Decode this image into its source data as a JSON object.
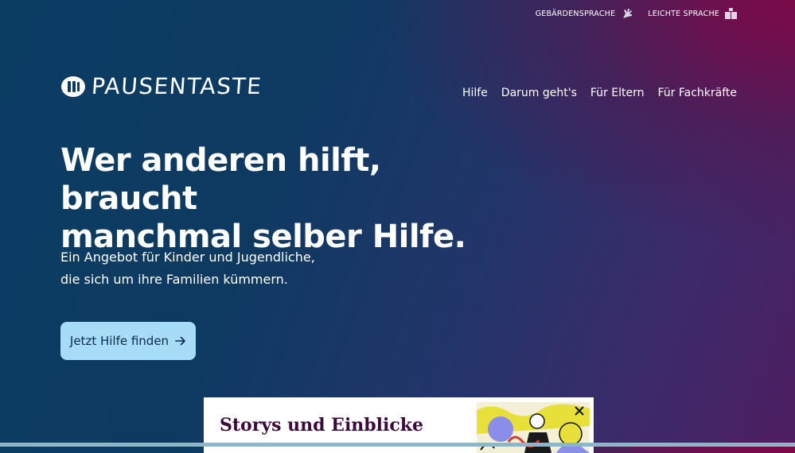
{
  "topbar": {
    "sign_language_label": "GEBÄRDENSPRACHE",
    "easy_language_label": "LEICHTE SPRACHE"
  },
  "logo": {
    "text": "PAUSENTASTE"
  },
  "nav": {
    "items": [
      {
        "label": "Hilfe"
      },
      {
        "label": "Darum geht's"
      },
      {
        "label": "Für Eltern"
      },
      {
        "label": "Für Fachkräfte"
      }
    ]
  },
  "hero": {
    "title_line1": "Wer anderen hilft, braucht",
    "title_line2": "manchmal selber Hilfe.",
    "subtitle_line1": "Ein Angebot für Kinder und Jugendliche,",
    "subtitle_line2": "die sich um ihre Familien kümmern.",
    "cta_label": "Jetzt Hilfe finden",
    "cta_icon": "arrow-right-icon"
  },
  "card": {
    "title": "Storys und Einblicke",
    "image": "illustration-people"
  },
  "colors": {
    "bg_blue": "#0b3d63",
    "bg_magenta": "#7a0a48",
    "cta_bg": "#a6dcf6",
    "card_title": "#3b0a3a"
  }
}
